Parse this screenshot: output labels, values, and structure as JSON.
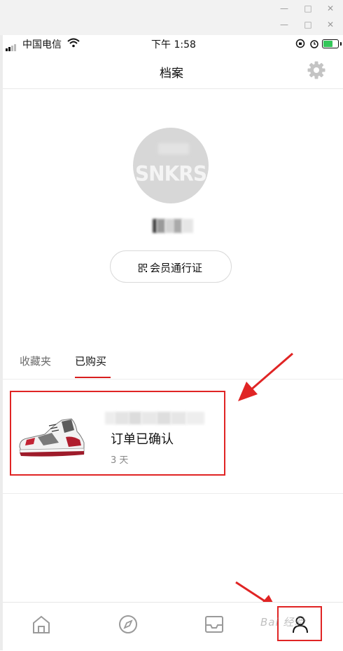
{
  "window": {
    "minimize_label": "—",
    "maximize_label": "□",
    "close_label": "✕"
  },
  "status_bar": {
    "carrier": "中国电信",
    "time": "下午 1:58",
    "battery_color": "#34c759",
    "battery_level": 0.7
  },
  "header": {
    "title": "档案",
    "settings_icon": "gear-icon"
  },
  "profile": {
    "avatar_text": "SNKRS",
    "pass_button_label": "会员通行证",
    "pass_icon": "qr-code-icon"
  },
  "tabs": [
    {
      "label": "收藏夹",
      "active": false
    },
    {
      "label": "已购买",
      "active": true
    }
  ],
  "order": {
    "status": "订单已确认",
    "time_ago": "3 天",
    "image_icon": "sneaker-image"
  },
  "tab_bar": {
    "items": [
      "home-icon",
      "compass-icon",
      "inbox-icon",
      "profile-icon"
    ],
    "active": "profile-icon"
  },
  "watermark": {
    "text": "Bai  经验"
  },
  "colors": {
    "accent": "#d81e1e",
    "annotation": "#e02424"
  }
}
